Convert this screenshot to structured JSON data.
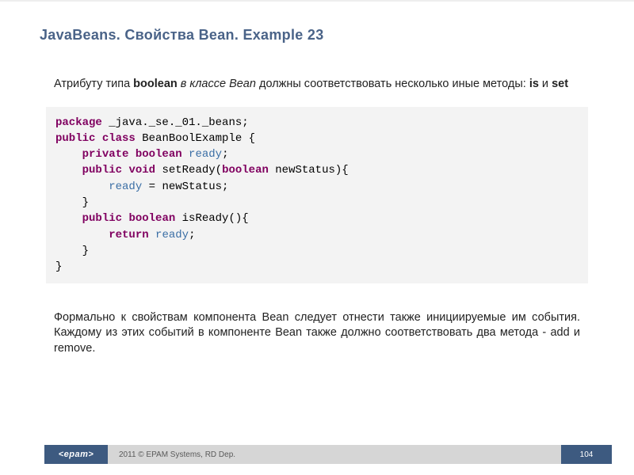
{
  "title": "JavaBeans. Свойства Bean. Example 23",
  "para1": {
    "t1": "Атрибуту типа ",
    "b1": "boolean",
    "t2": " ",
    "i1": "в классе Bean",
    "t3": " должны соответствовать несколько иные методы: ",
    "b2": "is",
    "t4": " и ",
    "b3": "set"
  },
  "code": {
    "l1_kw": "package",
    "l1_rest": " _java._se._01._beans;",
    "l2_kw1": "public",
    "l2_kw2": "class",
    "l2_rest": " BeanBoolExample {",
    "l3_kw1": "private",
    "l3_kw2": "boolean",
    "l3_fld": "ready",
    "l3_end": ";",
    "l4_kw1": "public",
    "l4_kw2": "void",
    "l4_mid": " setReady(",
    "l4_kw3": "boolean",
    "l4_rest": " newStatus){",
    "l5_fld": "ready",
    "l5_rest": " = newStatus;",
    "l6": "}",
    "l7_kw1": "public",
    "l7_kw2": "boolean",
    "l7_rest": " isReady(){",
    "l8_kw": "return",
    "l8_fld": "ready",
    "l8_end": ";",
    "l9": "}",
    "l10": "}"
  },
  "para2": "Формально к свойствам компонента Bean следует отнести также инициируемые им события. Каждому из этих событий в компоненте Bean также должно соответствовать два метода - add и remove.",
  "footer": {
    "logo": "<epam>",
    "copy": "2011 © EPAM Systems, RD Dep.",
    "page": "104"
  }
}
